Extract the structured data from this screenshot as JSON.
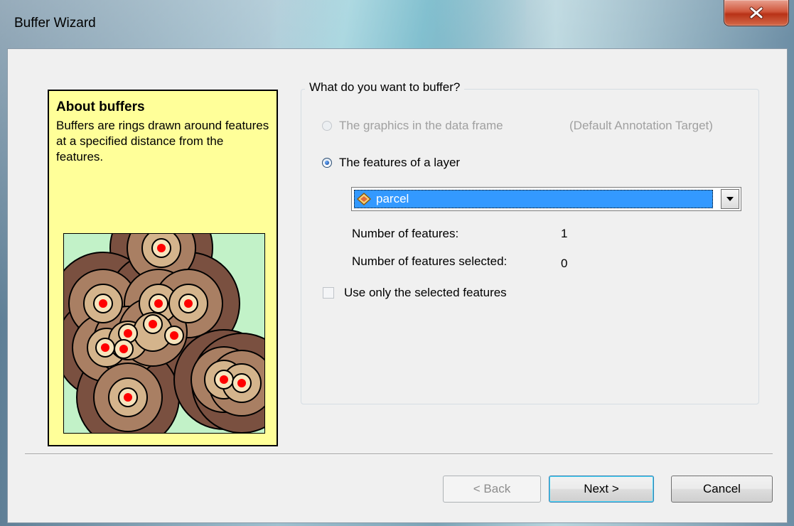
{
  "window": {
    "title": "Buffer Wizard"
  },
  "info_panel": {
    "title": "About  buffers",
    "text": "Buffers are rings drawn around features at a specified distance from the features."
  },
  "question": {
    "legend": "What do you want to buffer?",
    "option_graphics": "The graphics in the data frame",
    "option_graphics_target": "(Default Annotation Target)",
    "option_layer": "The features of a layer",
    "layer_value": "parcel",
    "num_features_label": "Number of features:",
    "num_features_value": "1",
    "num_selected_label": "Number of features selected:",
    "num_selected_value": "0",
    "use_selected_label": "Use only the selected features"
  },
  "buttons": {
    "back": "< Back",
    "next": "Next >",
    "cancel": "Cancel"
  },
  "colors": {
    "info_bg": "#ffff99",
    "selection": "#3399ff",
    "close_button": "#c8432a",
    "buffer_dark": "#7a5040",
    "buffer_mid": "#a97f63",
    "buffer_light": "#d4b48c",
    "feature_point": "#ff0000",
    "map_background": "#c2f2c8"
  }
}
